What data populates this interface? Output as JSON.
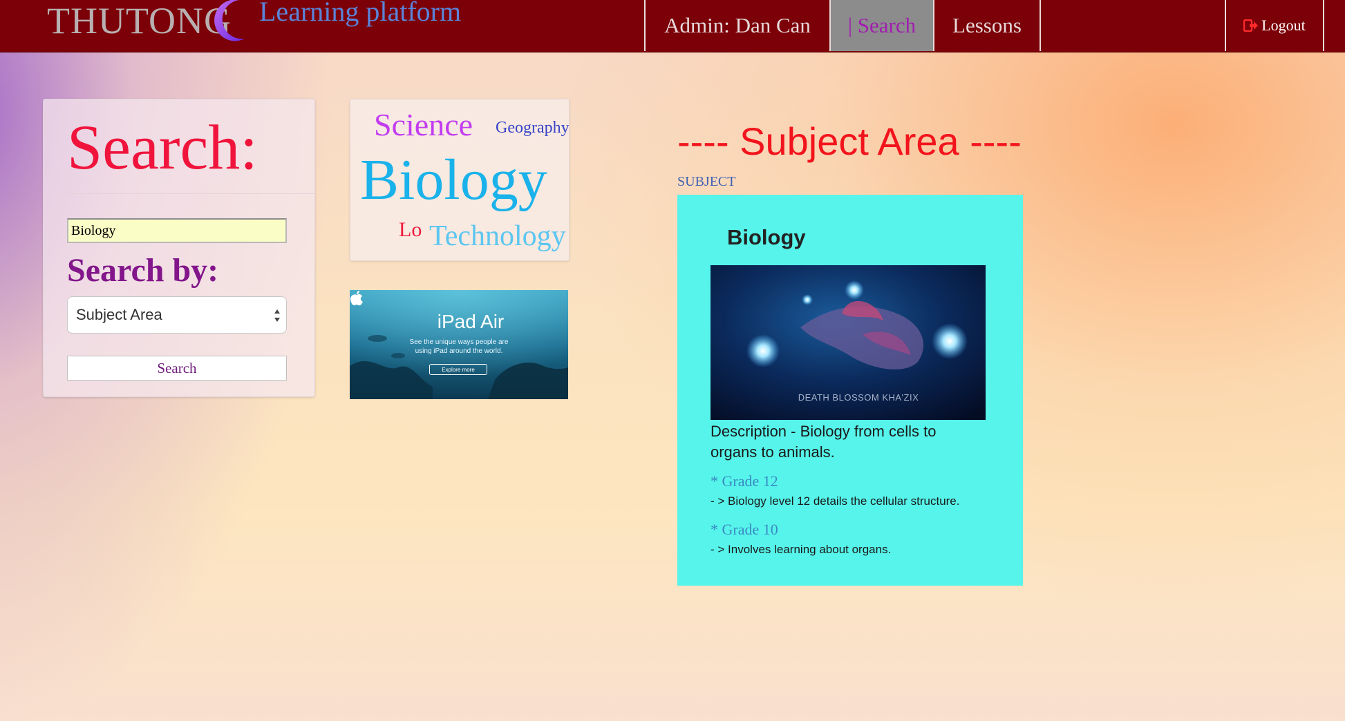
{
  "header": {
    "brand_name": "THUTONG",
    "brand_subtitle": "Learning platform",
    "nav": {
      "admin_label": "Admin: Dan Can",
      "search_label": "| Search",
      "lessons_label": "Lessons",
      "logout_label": "Logout"
    },
    "colors": {
      "bar": "#7c0008",
      "active_tab": "#8c8c8c"
    }
  },
  "search_panel": {
    "title": "Search:",
    "input_value": "Biology",
    "search_by_label": "Search by:",
    "selected_option": "Subject Area",
    "button_label": "Search"
  },
  "tag_cloud": {
    "tags": [
      "Science",
      "Geography",
      "Biology",
      "Lo",
      "Technology"
    ]
  },
  "ad": {
    "title": "iPad Air",
    "line1": "See the unique ways people are",
    "line2": "using iPad around the world.",
    "button_label": "Explore more"
  },
  "results": {
    "heading": "---- Subject Area ----",
    "subject_label": "SUBJECT",
    "card": {
      "title": "Biology",
      "image_caption": "DEATH BLOSSOM KHA'ZIX",
      "description": "Description - Biology from cells to organs to animals.",
      "grades": [
        {
          "label": "* Grade 12",
          "detail": "- > Biology level 12 details the cellular structure."
        },
        {
          "label": "* Grade 10",
          "detail": "- > Involves learning about organs."
        }
      ],
      "background": "#56f4ea"
    }
  }
}
